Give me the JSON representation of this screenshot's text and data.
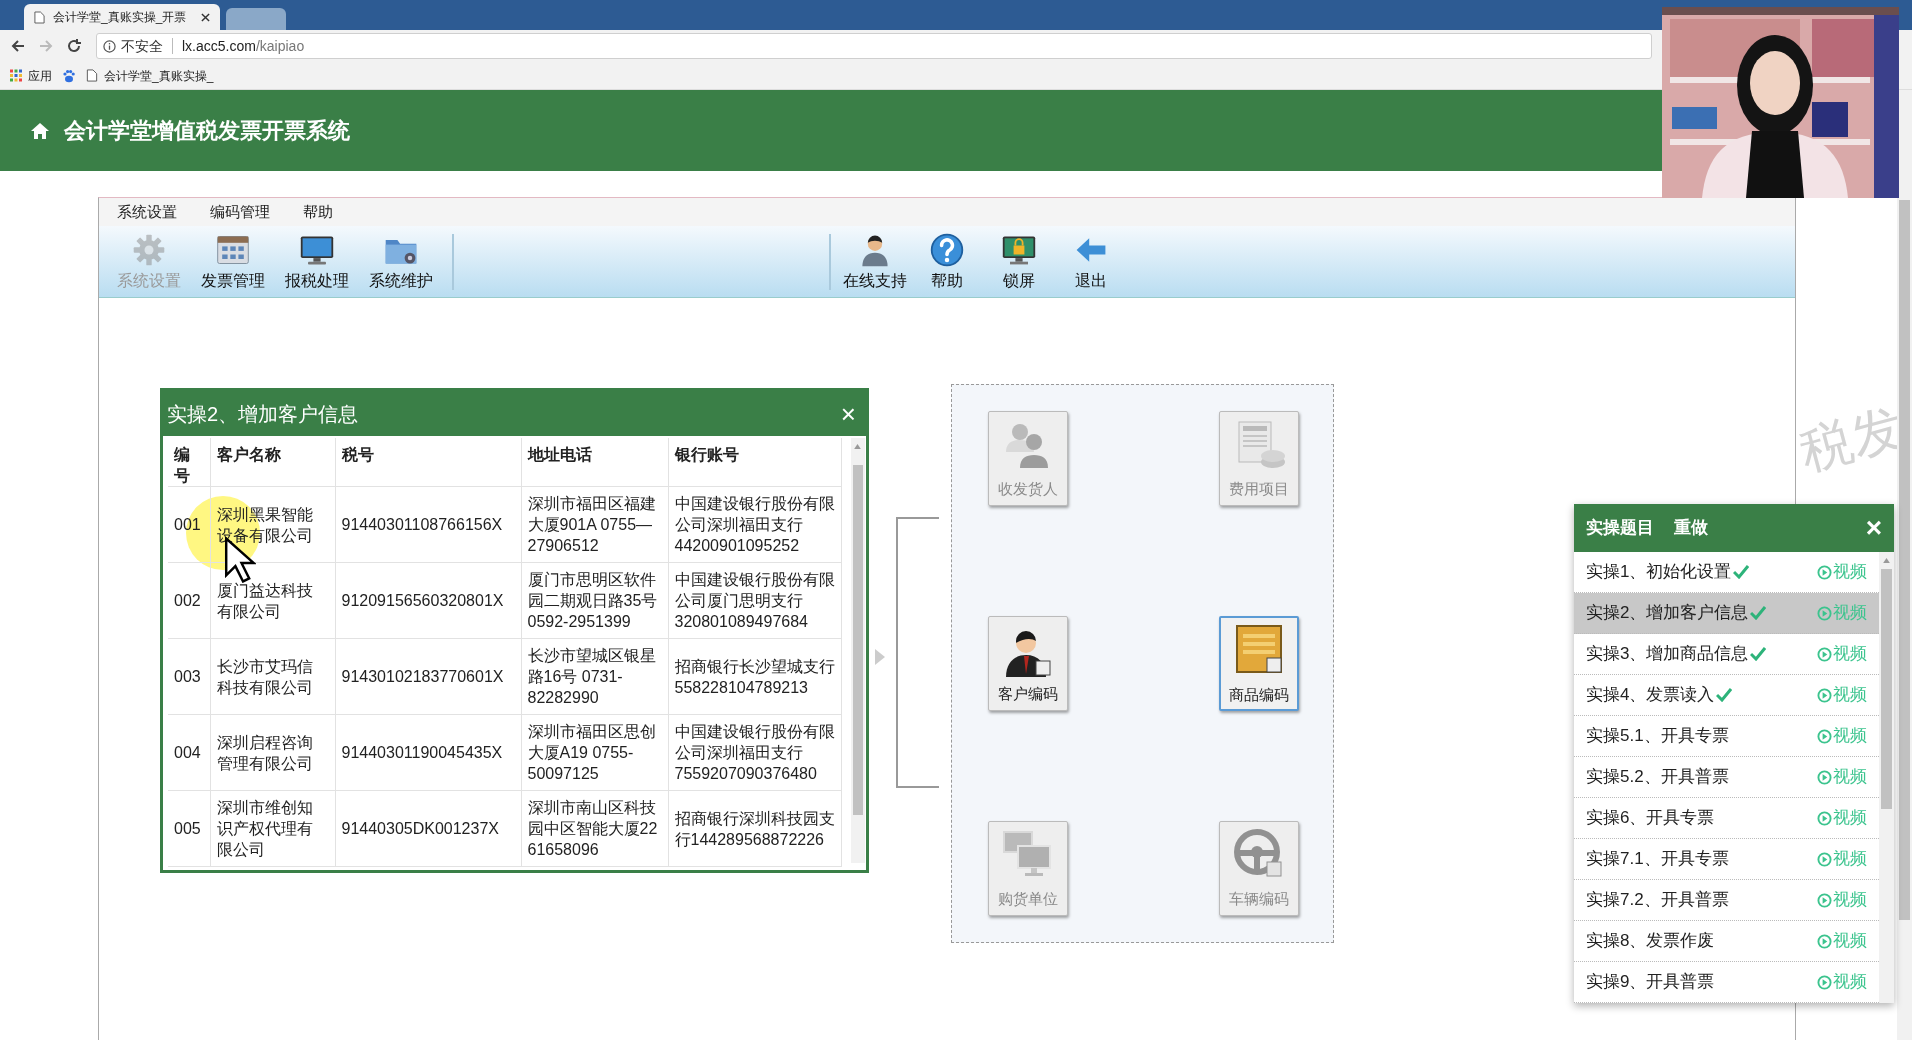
{
  "browser": {
    "tab_title": "会计学堂_真账实操_开票",
    "security": "不安全",
    "url_host": "lx.acc5.com",
    "url_path": "/kaipiao",
    "bookmarks": [
      {
        "kind": "apps",
        "label": "应用"
      },
      {
        "kind": "paw"
      },
      {
        "kind": "page",
        "label": "会计学堂_真账实操_"
      }
    ]
  },
  "header": {
    "title": "会计学堂增值税发票开票系统"
  },
  "menu": [
    "系统设置",
    "编码管理",
    "帮助"
  ],
  "toolbar": {
    "left": [
      {
        "kind": "gear",
        "label": "系统设置",
        "disabled": true
      },
      {
        "kind": "calendar",
        "label": "发票管理",
        "disabled": false
      },
      {
        "kind": "monitor",
        "label": "报税处理",
        "disabled": false
      },
      {
        "kind": "folder",
        "label": "系统维护",
        "disabled": false
      }
    ],
    "right": [
      {
        "kind": "person",
        "label": "在线支持",
        "disabled": false
      },
      {
        "kind": "help",
        "label": "帮助",
        "disabled": false
      },
      {
        "kind": "lock",
        "label": "锁屏",
        "disabled": false
      },
      {
        "kind": "exit",
        "label": "退出",
        "disabled": false
      }
    ]
  },
  "background_text": "税发",
  "tiles": [
    {
      "kind": "people",
      "label": "收发货人",
      "disabled": true,
      "selected": false
    },
    {
      "kind": "document",
      "label": "费用项目",
      "disabled": true,
      "selected": false
    },
    {
      "kind": "customer",
      "label": "客户编码",
      "disabled": false,
      "selected": false
    },
    {
      "kind": "crate",
      "label": "商品编码",
      "disabled": false,
      "selected": true
    },
    {
      "kind": "computers",
      "label": "购货单位",
      "disabled": true,
      "selected": false
    },
    {
      "kind": "wheel",
      "label": "车辆编码",
      "disabled": true,
      "selected": false
    }
  ],
  "dialog": {
    "title": "实操2、增加客户信息",
    "close": "×",
    "columns": [
      "编号",
      "客户名称",
      "税号",
      "地址电话",
      "银行账号"
    ],
    "rows": [
      [
        "001",
        "深圳黑果智能设备有限公司",
        "91440301108766156X",
        "深圳市福田区福建大厦901A 0755—27906512",
        "中国建设银行股份有限公司深圳福田支行44200901095252"
      ],
      [
        "002",
        "厦门益达科技有限公司",
        "91209156560320801X",
        "厦门市思明区软件园二期观日路35号0592-2951399",
        "中国建设银行股份有限公司厦门思明支行320801089497684"
      ],
      [
        "003",
        "长沙市艾玛信科技有限公司",
        "91430102183770601X",
        "长沙市望城区银星路16号 0731-82282990",
        "招商银行长沙望城支行558228104789213"
      ],
      [
        "004",
        "深圳启程咨询管理有限公司",
        "91440301190045435X",
        "深圳市福田区思创大厦A19 0755-50097125",
        "中国建设银行股份有限公司深圳福田支行7559207090376480"
      ],
      [
        "005",
        "深圳市维创知识产权代理有限公司",
        "91440305DK001237X",
        "深圳市南山区科技园中区智能大厦22 61658096",
        "招商银行深圳科技园支行144289568872226"
      ]
    ]
  },
  "tasks": {
    "title": "实操题目",
    "redo": "重做",
    "close": "×",
    "items": [
      {
        "label": "实操1、初始化设置",
        "done": true,
        "selected": false,
        "video": "视频"
      },
      {
        "label": "实操2、增加客户信息",
        "done": true,
        "selected": true,
        "video": "视频"
      },
      {
        "label": "实操3、增加商品信息",
        "done": true,
        "selected": false,
        "video": "视频"
      },
      {
        "label": "实操4、发票读入",
        "done": true,
        "selected": false,
        "video": "视频"
      },
      {
        "label": "实操5.1、开具专票",
        "done": false,
        "selected": false,
        "video": "视频"
      },
      {
        "label": "实操5.2、开具普票",
        "done": false,
        "selected": false,
        "video": "视频"
      },
      {
        "label": "实操6、开具专票",
        "done": false,
        "selected": false,
        "video": "视频"
      },
      {
        "label": "实操7.1、开具专票",
        "done": false,
        "selected": false,
        "video": "视频"
      },
      {
        "label": "实操7.2、开具普票",
        "done": false,
        "selected": false,
        "video": "视频"
      },
      {
        "label": "实操8、发票作废",
        "done": false,
        "selected": false,
        "video": "视频"
      },
      {
        "label": "实操9、开具普票",
        "done": false,
        "selected": false,
        "video": "视频"
      }
    ]
  }
}
